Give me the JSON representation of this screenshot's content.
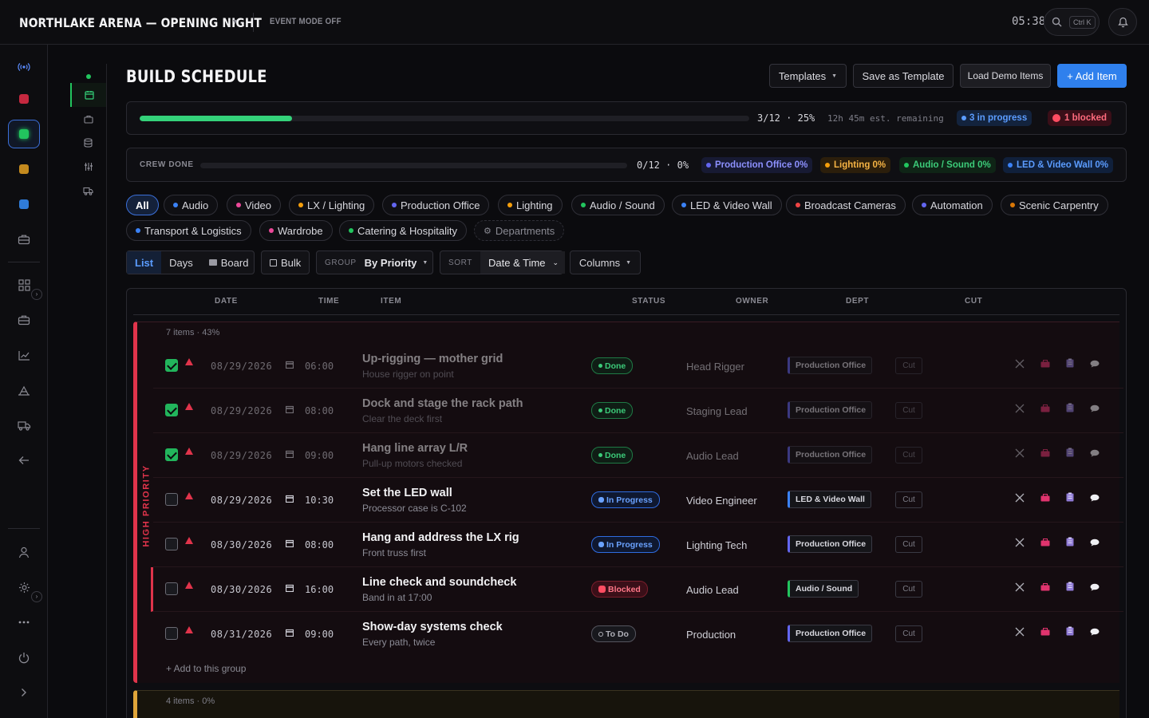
{
  "app": {
    "title": "NORTHLAKE ARENA — OPENING NIGHT",
    "event_mode": "EVENT MODE OFF",
    "clock": "05:38",
    "search_kbd": "Ctrl K"
  },
  "page": {
    "title": "BUILD SCHEDULE"
  },
  "header_buttons": {
    "templates": "Templates",
    "save_template": "Save as Template",
    "load_demo": "Load Demo Items",
    "add_item": "+ Add Item"
  },
  "progress": {
    "fraction": 0.25,
    "count": "3/12",
    "percent": "25%",
    "remaining": "12h 45m est. remaining",
    "in_progress": "3 in progress",
    "blocked": "1 blocked"
  },
  "crew": {
    "label": "CREW DONE",
    "fraction": 0,
    "count": "0/12",
    "percent": "0%",
    "depts": [
      {
        "label": "Production Office 0%",
        "color": "#6366f1"
      },
      {
        "label": "Lighting 0%",
        "color": "#f59e0b"
      },
      {
        "label": "Audio / Sound 0%",
        "color": "#22c55e"
      },
      {
        "label": "LED & Video Wall 0%",
        "color": "#3b82f6"
      }
    ]
  },
  "filters": [
    {
      "label": "All"
    },
    {
      "label": "Audio",
      "color": "#3b82f6"
    },
    {
      "label": "Video",
      "color": "#ec4899"
    },
    {
      "label": "LX / Lighting",
      "color": "#f59e0b"
    },
    {
      "label": "Production Office",
      "color": "#6366f1"
    },
    {
      "label": "Lighting",
      "color": "#f59e0b"
    },
    {
      "label": "Audio / Sound",
      "color": "#22c55e"
    },
    {
      "label": "LED & Video Wall",
      "color": "#3b82f6"
    },
    {
      "label": "Broadcast Cameras",
      "color": "#ef4444"
    },
    {
      "label": "Automation",
      "color": "#6366f1"
    },
    {
      "label": "Scenic Carpentry",
      "color": "#d97706"
    },
    {
      "label": "Transport & Logistics",
      "color": "#3b82f6"
    },
    {
      "label": "Wardrobe",
      "color": "#ec4899"
    },
    {
      "label": "Catering & Hospitality",
      "color": "#22c55e"
    },
    {
      "label": "Departments"
    }
  ],
  "views": {
    "list": "List",
    "days": "Days",
    "board": "Board",
    "bulk": "Bulk",
    "group_label": "GROUP",
    "group_value": "By Priority",
    "sort_label": "SORT",
    "sort_value": "Date & Time",
    "columns": "Columns"
  },
  "table": {
    "headers": {
      "date": "DATE",
      "time": "TIME",
      "item": "ITEM",
      "status": "STATUS",
      "owner": "OWNER",
      "dept": "DEPT",
      "cut": "CUT"
    },
    "group1": {
      "label": "HIGH PRIORITY",
      "meta": "7 items · 43%",
      "add": "+ Add to this group"
    },
    "group2": {
      "meta": "4 items · 0%"
    },
    "rows": [
      {
        "checked": true,
        "date": "08/29/2026",
        "time": "06:00",
        "title": "Up-rigging — mother grid",
        "sub": "House rigger on point",
        "status": "Done",
        "owner": "Head Rigger",
        "dept": "Production Office",
        "cut": "Cut"
      },
      {
        "checked": true,
        "date": "08/29/2026",
        "time": "08:00",
        "title": "Dock and stage the rack path",
        "sub": "Clear the deck first",
        "status": "Done",
        "owner": "Staging Lead",
        "dept": "Production Office",
        "cut": "Cut"
      },
      {
        "checked": true,
        "date": "08/29/2026",
        "time": "09:00",
        "title": "Hang line array L/R",
        "sub": "Pull-up motors checked",
        "status": "Done",
        "owner": "Audio Lead",
        "dept": "Production Office",
        "cut": "Cut"
      },
      {
        "checked": false,
        "date": "08/29/2026",
        "time": "10:30",
        "title": "Set the LED wall",
        "sub": "Processor case is C-102",
        "status": "In Progress",
        "owner": "Video Engineer",
        "dept": "LED & Video Wall",
        "cut": "Cut"
      },
      {
        "checked": false,
        "date": "08/30/2026",
        "time": "08:00",
        "title": "Hang and address the LX rig",
        "sub": "Front truss first",
        "status": "In Progress",
        "owner": "Lighting Tech",
        "dept": "Production Office",
        "cut": "Cut"
      },
      {
        "checked": false,
        "date": "08/30/2026",
        "time": "16:00",
        "title": "Line check and soundcheck",
        "sub": "Band in at 17:00",
        "status": "Blocked",
        "owner": "Audio Lead",
        "dept": "Audio / Sound",
        "cut": "Cut"
      },
      {
        "checked": false,
        "date": "08/31/2026",
        "time": "09:00",
        "title": "Show-day systems check",
        "sub": "Every path, twice",
        "status": "To Do",
        "owner": "Production",
        "dept": "Production Office",
        "cut": "Cut"
      }
    ]
  },
  "colors": {
    "accent": "#2f80ed",
    "success": "#34d27a",
    "danger": "#e0344b",
    "warning": "#e0a53a"
  }
}
